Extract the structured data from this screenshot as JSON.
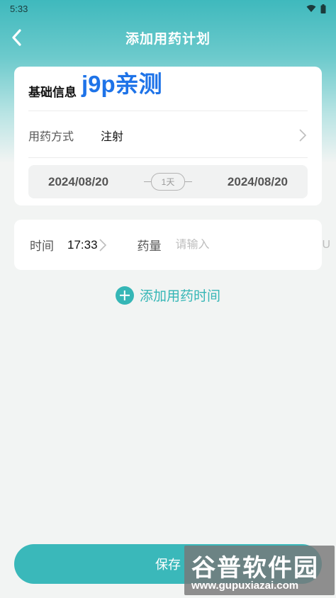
{
  "status_bar": {
    "time": "5:33"
  },
  "nav": {
    "title": "添加用药计划",
    "back_icon": "chevron-left-icon"
  },
  "watermark": {
    "text": "j9p亲测"
  },
  "basic_info": {
    "title": "基础信息",
    "method_label": "用药方式",
    "method_value": "注射",
    "start_date": "2024/08/20",
    "days": "1天",
    "end_date": "2024/08/20"
  },
  "schedule": {
    "time_label": "时间",
    "time_value": "17:33",
    "dose_label": "药量",
    "dose_placeholder": "请输入",
    "dose_unit": "U"
  },
  "add_time": {
    "label": "添加用药时间"
  },
  "save": {
    "label": "保存"
  },
  "logo": {
    "name": "谷普软件园",
    "url": "www.gupuxiazai.com"
  },
  "colors": {
    "accent": "#35b6b6",
    "header": "#3fb9bd"
  }
}
